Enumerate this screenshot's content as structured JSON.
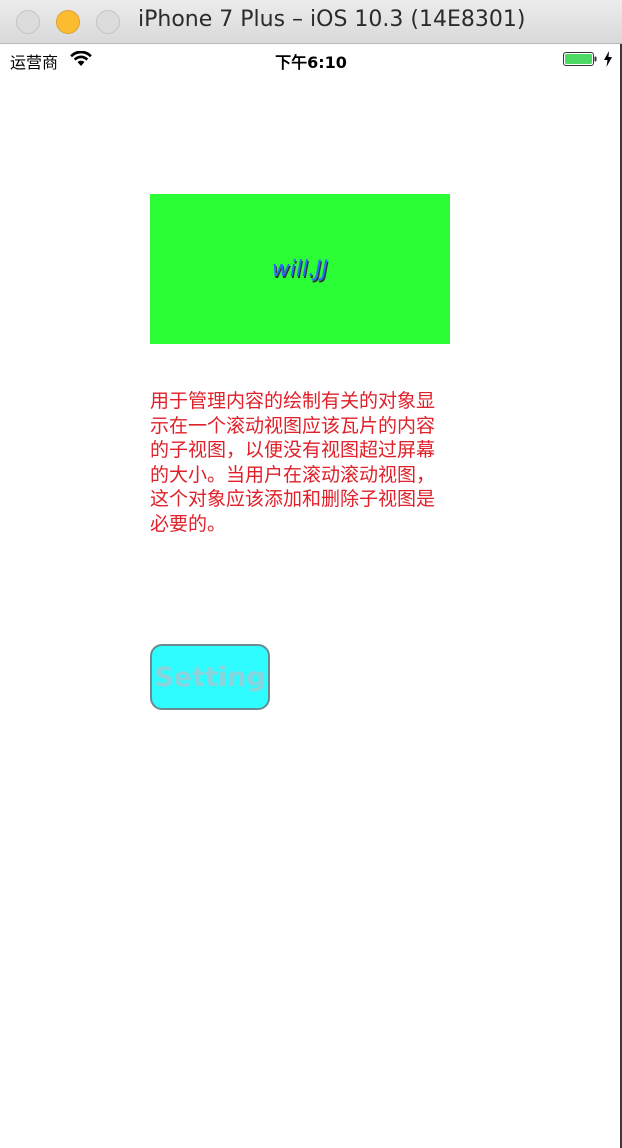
{
  "window": {
    "title": "iPhone 7 Plus – iOS 10.3 (14E8301)"
  },
  "status_bar": {
    "carrier": "运营商",
    "time": "下午6:10",
    "icons": [
      "wifi-icon",
      "battery-icon",
      "charging-bolt-icon"
    ]
  },
  "app": {
    "green_view": {
      "label": "will.JJ",
      "background": "#2bfd37",
      "label_color": "#2b6cff"
    },
    "description": {
      "text": "用于管理内容的绘制有关的对象显示在一个滚动视图应该瓦片的内容的子视图，以便没有视图超过屏幕的大小。当用户在滚动滚动视图，这个对象应该添加和删除子视图是必要的。",
      "color": "#e0202a"
    },
    "setting_button": {
      "label": "Setting",
      "background": "#2ffcff"
    }
  }
}
